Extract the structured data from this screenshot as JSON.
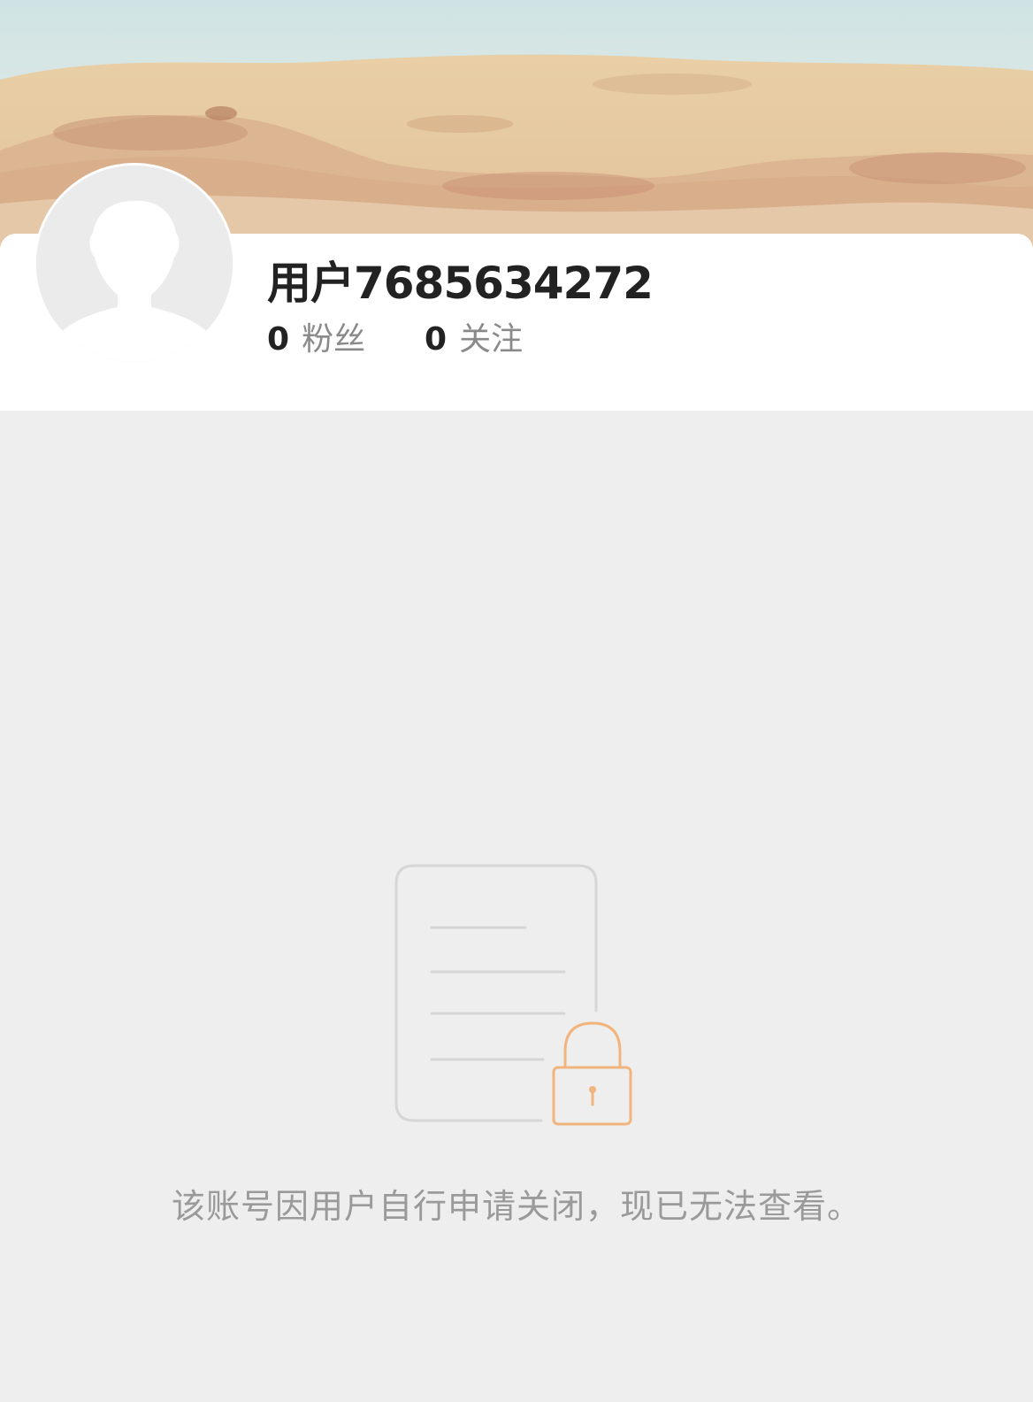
{
  "cover": {
    "icon": "sand-beach-cover-image"
  },
  "profile": {
    "avatar_icon": "default-user-avatar-icon",
    "username": "用户7685634272",
    "fans": {
      "count": "0",
      "label": "粉丝"
    },
    "following": {
      "count": "0",
      "label": "关注"
    }
  },
  "empty_state": {
    "icon": "locked-document-icon",
    "message": "该账号因用户自行申请关闭，现已无法查看。"
  },
  "colors": {
    "background": "#eeeeee",
    "card": "#ffffff",
    "lock_accent": "#f0b47c",
    "document_stroke": "#d6d6d6"
  }
}
